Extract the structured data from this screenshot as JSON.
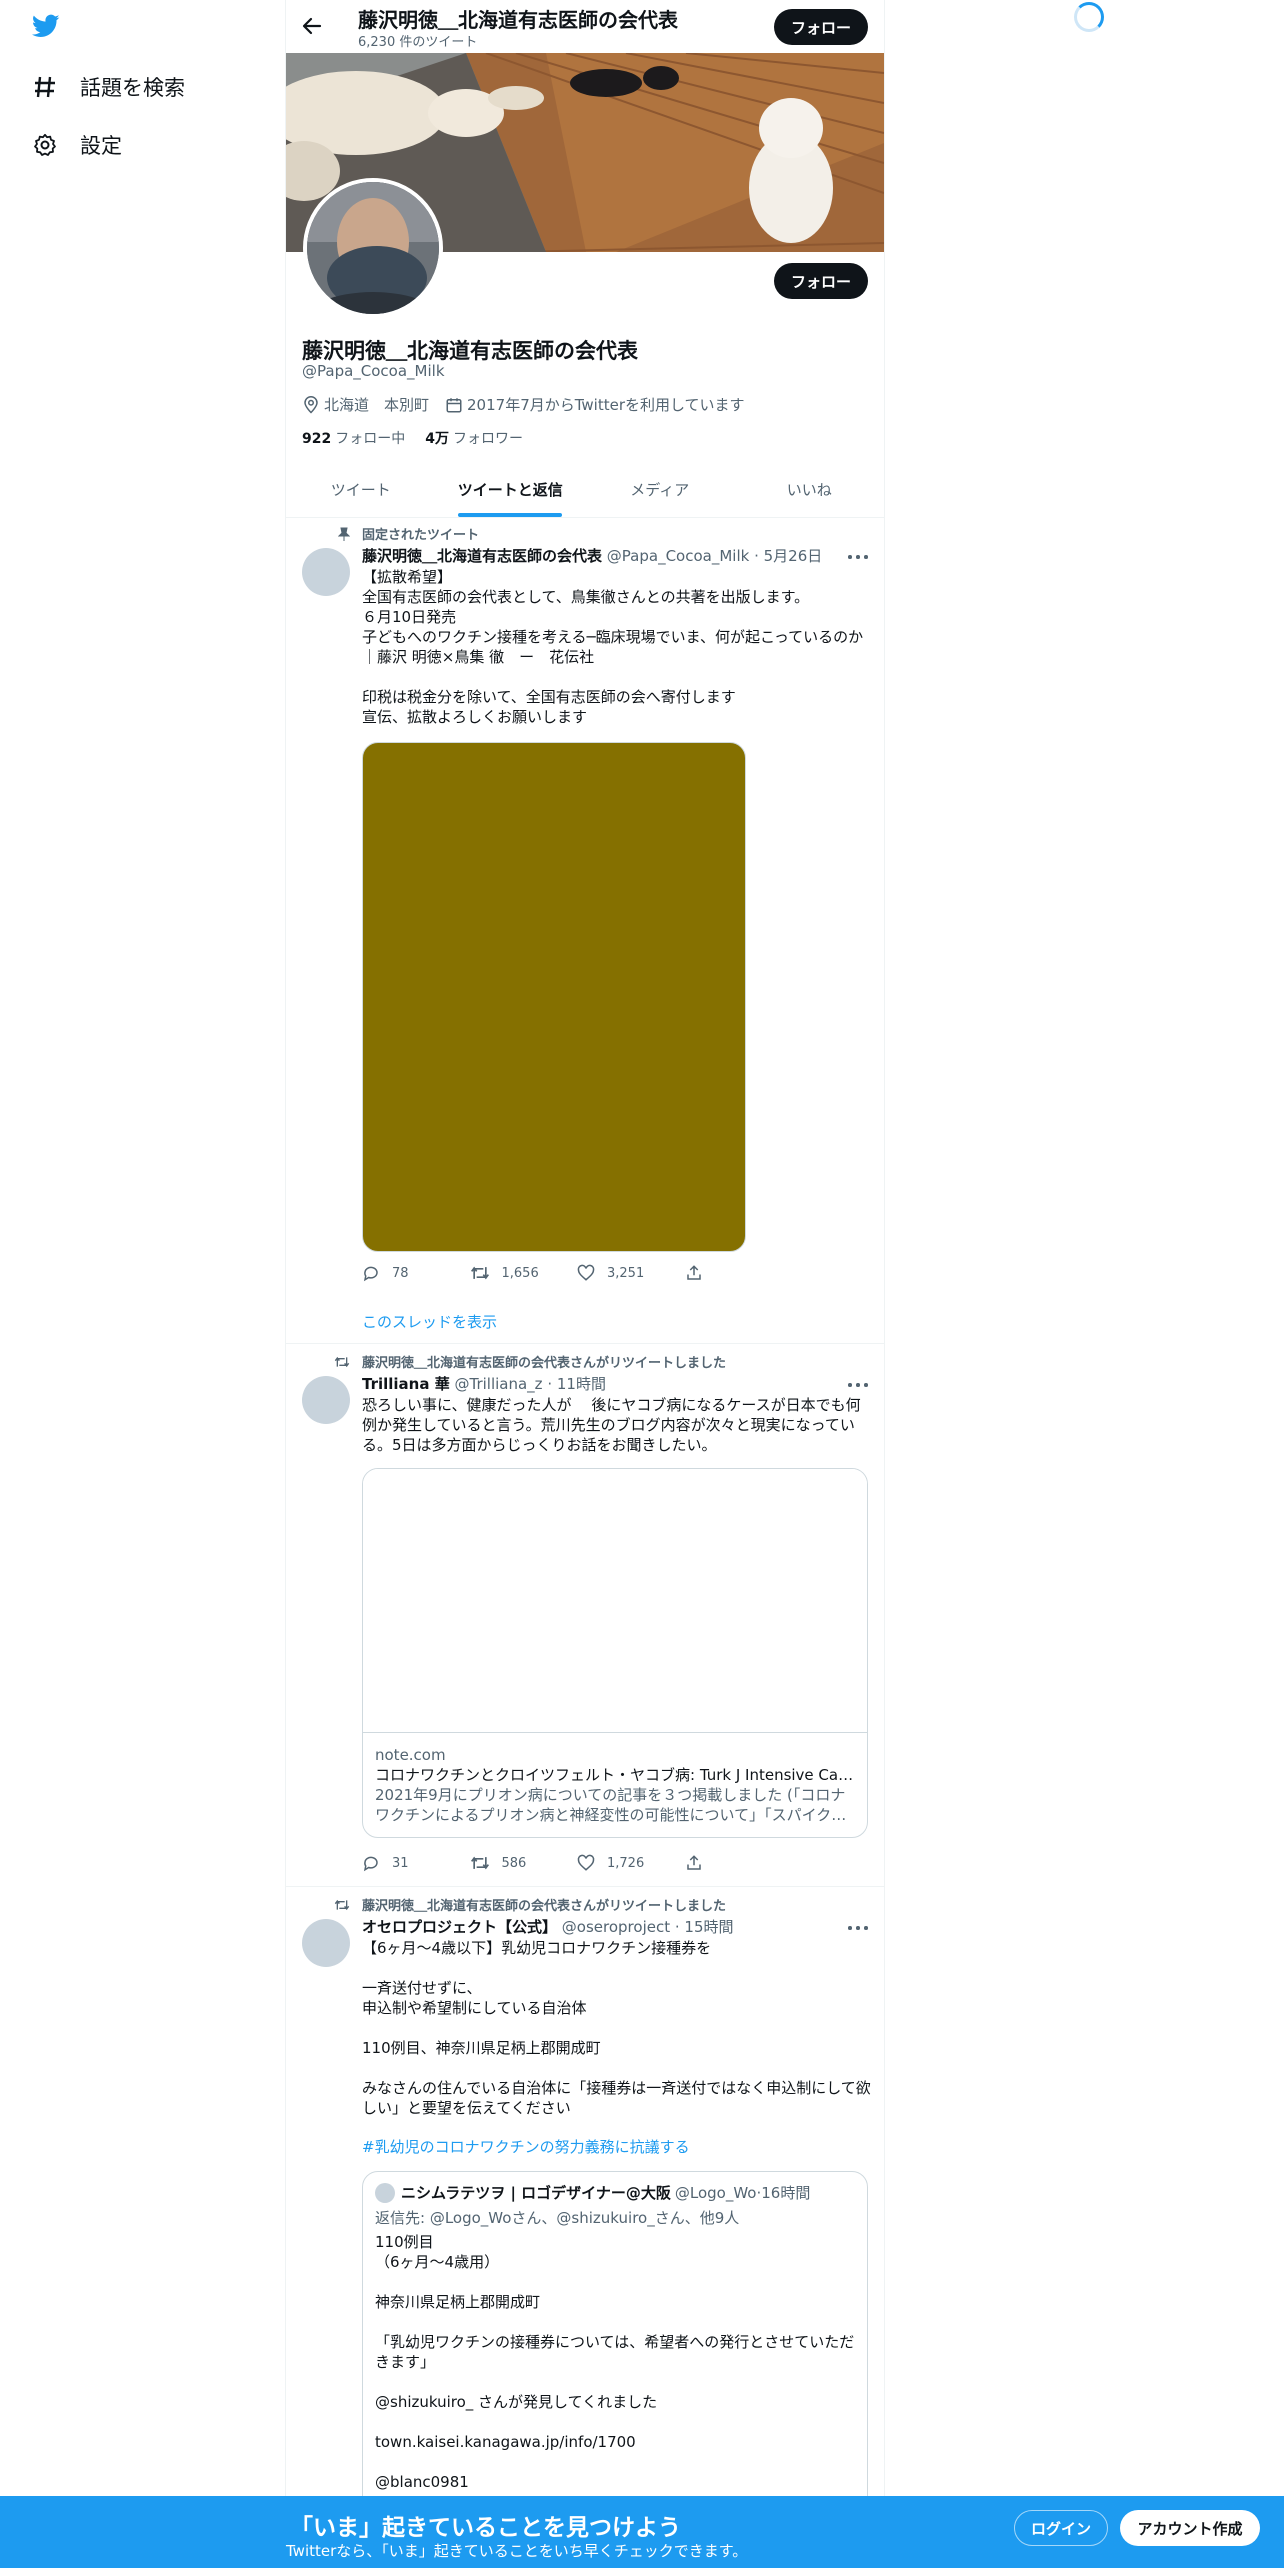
{
  "nav": {
    "explore_label": "話題を検索",
    "settings_label": "設定"
  },
  "colors": {
    "accent": "#1d9bf0",
    "text": "#0f1419",
    "muted": "#536471",
    "media_placeholder": "#857000"
  },
  "header": {
    "name": "藤沢明徳＿北海道有志医師の会代表",
    "tweet_count": "6,230 件のツイート",
    "follow_label": "フォロー"
  },
  "profile": {
    "name": "藤沢明徳＿北海道有志医師の会代表",
    "handle": "@Papa_Cocoa_Milk",
    "location": "北海道　本別町",
    "joined": "2017年7月からTwitterを利用しています",
    "following_count": "922",
    "following_label": "フォロー中",
    "followers_count": "4万",
    "followers_label": "フォロワー",
    "follow_label": "フォロー"
  },
  "tabs": [
    {
      "label": "ツイート"
    },
    {
      "label": "ツイートと返信"
    },
    {
      "label": "メディア"
    },
    {
      "label": "いいね"
    }
  ],
  "tweets": [
    {
      "context": "固定されたツイート",
      "author": "藤沢明徳＿北海道有志医師の会代表",
      "handle": "@Papa_Cocoa_Milk",
      "time": "5月26日",
      "text": "【拡散希望】\n全国有志医師の会代表として、鳥集徹さんとの共著を出版します。\n６月10日発売\n子どもへのワクチン接種を考える─臨床現場でいま、何が起こっているのか ｜藤沢 明徳×鳥集 徹　ー　花伝社\n\n印税は税金分を除いて、全国有志医師の会へ寄付します\n宣伝、拡散よろしくお願いします",
      "replies": "78",
      "retweets": "1,656",
      "likes": "3,251",
      "show_thread": "このスレッドを表示"
    },
    {
      "context": "藤沢明徳＿北海道有志医師の会代表さんがリツイートしました",
      "author": "Trilliana 華",
      "handle": "@Trilliana_z",
      "time": "11時間",
      "text": "恐ろしい事に、健康だった人が　 後にヤコブ病になるケースが日本でも何例か発生していると言う。荒川先生のブログ内容が次々と現実になっている。5日は多方面からじっくりお話をお聞きしたい。",
      "card": {
        "domain": "note.com",
        "title": "コロナワクチンとクロイツフェルト・ヤコブ病: Turk J Intensive Care…",
        "desc": "2021年9月にプリオン病についての記事を３つ掲載しました (「コロナワクチンによるプリオン病と神経変性の可能性について」「スパイク…"
      },
      "replies": "31",
      "retweets": "586",
      "likes": "1,726"
    },
    {
      "context": "藤沢明徳＿北海道有志医師の会代表さんがリツイートしました",
      "author": "オセロプロジェクト【公式】",
      "handle": "@oseroproject",
      "time": "15時間",
      "text": "【6ヶ月～4歳以下】乳幼児コロナワクチン接種券を\n\n一斉送付せずに、\n申込制や希望制にしている自治体\n\n110例目、神奈川県足柄上郡開成町\n\nみなさんの住んでいる自治体に「接種券は一斉送付ではなく申込制にして欲しい」と要望を伝えてください",
      "hashtag": "#乳幼児のコロナワクチンの努力義務に抗議する",
      "quote": {
        "author": "ニシムラテツヲ | ロゴデザイナー@大阪",
        "handle": "@Logo_Wo",
        "time": "16時間",
        "reply_to": "返信先: @Logo_Woさん、@shizukuiro_さん、他9人",
        "text": "110例目\n（6ヶ月〜4歳用）\n\n神奈川県足柄上郡開成町\n\n「乳幼児ワクチンの接種券については、希望者への発行とさせていただきます」\n\n@shizukuiro_ さんが発見してくれました\n\ntown.kaisei.kanagawa.jp/info/1700\n\n@blanc0981"
      }
    }
  ],
  "bottom_bar": {
    "title": "「いま」起きていることを見つけよう",
    "subtitle": "Twitterなら、「いま」起きていることをいち早くチェックできます。",
    "login_label": "ログイン",
    "signup_label": "アカウント作成"
  }
}
